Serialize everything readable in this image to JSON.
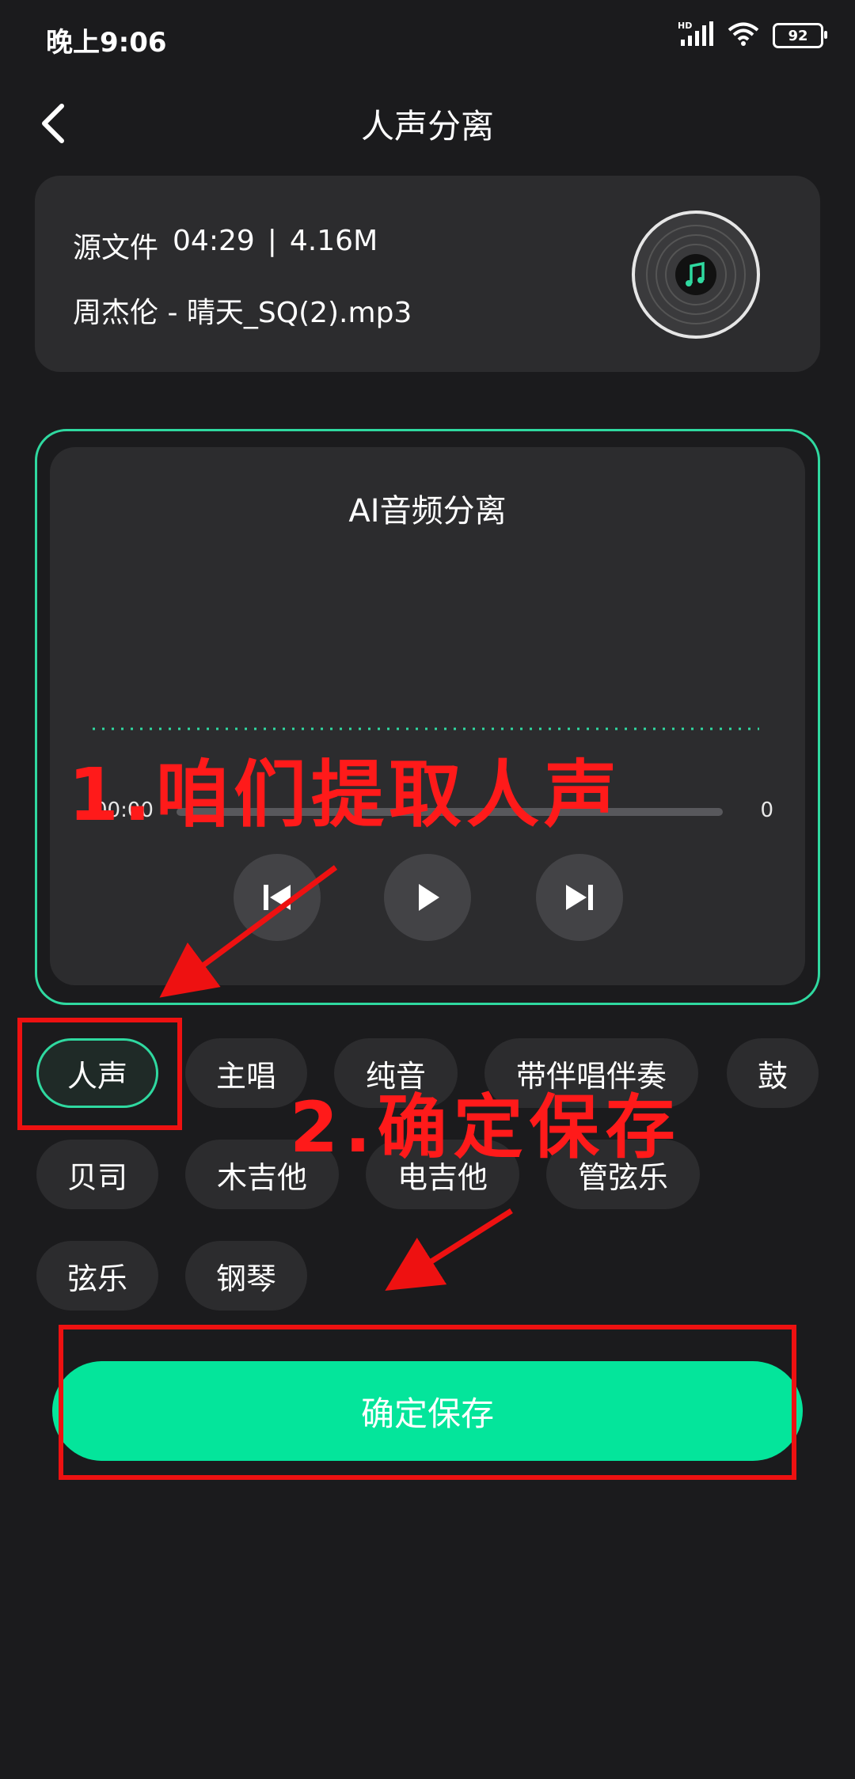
{
  "status_bar": {
    "time": "晚上9:06",
    "network": "HD",
    "battery": "92"
  },
  "header": {
    "title": "人声分离"
  },
  "source": {
    "label": "源文件",
    "duration": "04:29",
    "separator": "|",
    "size": "4.16M",
    "file_name": "周杰伦 - 晴天_SQ(2).mp3"
  },
  "player": {
    "title": "AI音频分离",
    "time_current": "00:00",
    "time_total": "0"
  },
  "chips": [
    {
      "label": "人声",
      "selected": true
    },
    {
      "label": "主唱",
      "selected": false
    },
    {
      "label": "纯音",
      "selected": false
    },
    {
      "label": "带伴唱伴奏",
      "selected": false
    },
    {
      "label": "鼓",
      "selected": false
    },
    {
      "label": "贝司",
      "selected": false
    },
    {
      "label": "木吉他",
      "selected": false
    },
    {
      "label": "电吉他",
      "selected": false
    },
    {
      "label": "管弦乐",
      "selected": false
    },
    {
      "label": "弦乐",
      "selected": false
    },
    {
      "label": "钢琴",
      "selected": false
    }
  ],
  "save_button": {
    "label": "确定保存"
  },
  "annotations": {
    "step1": "1.咱们提取人声",
    "step2": "2.确定保存"
  },
  "colors": {
    "accent": "#04e59b",
    "outline": "#2fd9a0",
    "annotation": "#ff1a1a",
    "background": "#1b1b1d"
  }
}
